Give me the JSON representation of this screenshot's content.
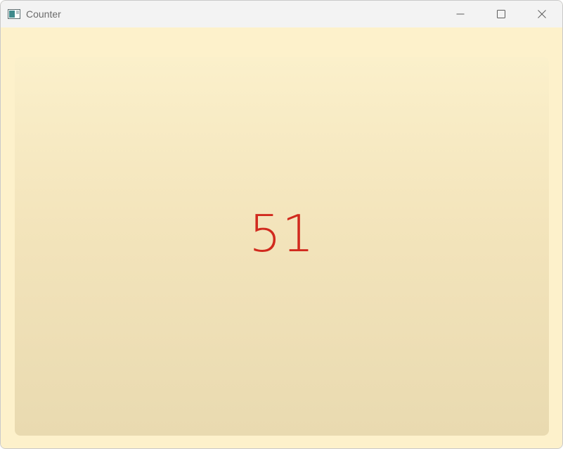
{
  "window": {
    "title": "Counter",
    "icon": "app-window-icon",
    "controls": {
      "minimize_icon": "minimize-icon",
      "maximize_icon": "maximize-icon",
      "close_icon": "close-icon"
    }
  },
  "counter": {
    "value": "51",
    "color": "#d12a1e"
  },
  "colors": {
    "background": "#fdf1cb",
    "panel_top": "#fbf0cb",
    "panel_bottom": "#e9dab0"
  }
}
